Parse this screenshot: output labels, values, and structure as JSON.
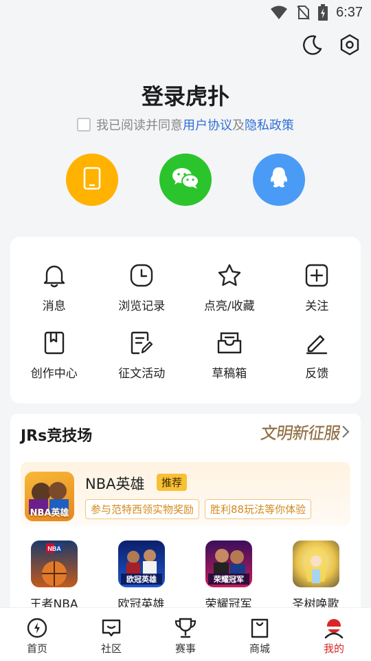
{
  "status_bar": {
    "time": "6:37"
  },
  "login": {
    "title": "登录虎扑",
    "agree_prefix": "我已阅读并同意",
    "user_agreement": "用户协议",
    "and": "及",
    "privacy_policy": "隐私政策",
    "methods": [
      {
        "name": "phone",
        "color": "#ffb200"
      },
      {
        "name": "wechat",
        "color": "#2bc42c"
      },
      {
        "name": "qq",
        "color": "#4a9bf6"
      }
    ]
  },
  "menu": {
    "items": [
      {
        "label": "消息",
        "icon": "bell-icon"
      },
      {
        "label": "浏览记录",
        "icon": "clock-icon"
      },
      {
        "label": "点亮/收藏",
        "icon": "star-icon"
      },
      {
        "label": "关注",
        "icon": "plus-square-icon"
      },
      {
        "label": "创作中心",
        "icon": "book-icon"
      },
      {
        "label": "征文活动",
        "icon": "edit-doc-icon"
      },
      {
        "label": "草稿箱",
        "icon": "inbox-icon"
      },
      {
        "label": "反馈",
        "icon": "pencil-icon"
      }
    ]
  },
  "arena": {
    "title": "JRs竞技场",
    "banner": "文明新征服",
    "promo": {
      "icon_label": "NBA英雄",
      "name": "NBA英雄",
      "tag": "推荐",
      "chips": [
        "参与范特西领实物奖励",
        "胜利88玩法等你体验"
      ]
    },
    "games": [
      {
        "name": "王者NBA",
        "icon_text": "NBA"
      },
      {
        "name": "欧冠英雄",
        "icon_text": "欧冠英雄"
      },
      {
        "name": "荣耀冠军",
        "icon_text": "荣耀冠军"
      },
      {
        "name": "圣树唤歌",
        "icon_text": ""
      }
    ]
  },
  "tabbar": {
    "tabs": [
      {
        "label": "首页"
      },
      {
        "label": "社区"
      },
      {
        "label": "赛事"
      },
      {
        "label": "商城"
      },
      {
        "label": "我的"
      }
    ],
    "active_color": "#d92626"
  }
}
